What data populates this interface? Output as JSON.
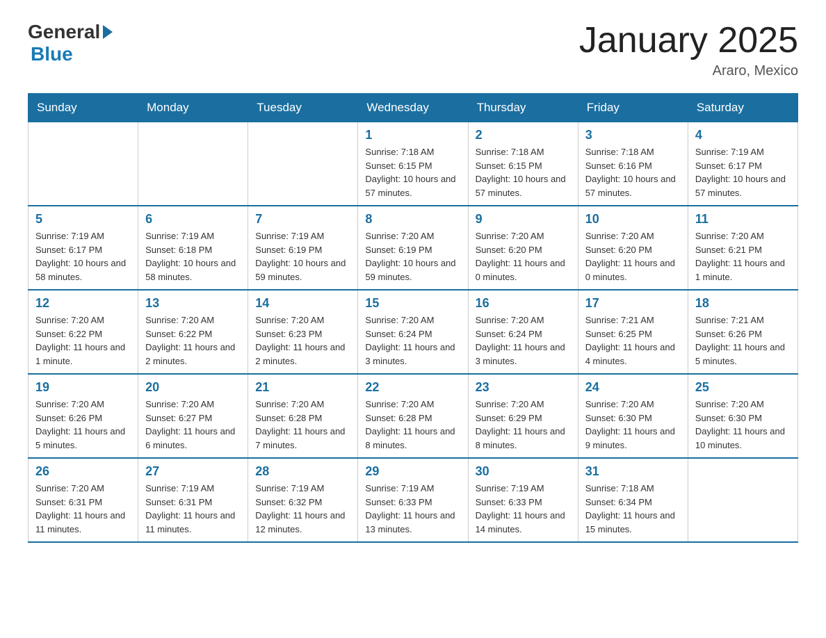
{
  "logo": {
    "general": "General",
    "blue": "Blue"
  },
  "header": {
    "title": "January 2025",
    "subtitle": "Araro, Mexico"
  },
  "days_of_week": [
    "Sunday",
    "Monday",
    "Tuesday",
    "Wednesday",
    "Thursday",
    "Friday",
    "Saturday"
  ],
  "weeks": [
    [
      {
        "day": "",
        "info": ""
      },
      {
        "day": "",
        "info": ""
      },
      {
        "day": "",
        "info": ""
      },
      {
        "day": "1",
        "info": "Sunrise: 7:18 AM\nSunset: 6:15 PM\nDaylight: 10 hours and 57 minutes."
      },
      {
        "day": "2",
        "info": "Sunrise: 7:18 AM\nSunset: 6:15 PM\nDaylight: 10 hours and 57 minutes."
      },
      {
        "day": "3",
        "info": "Sunrise: 7:18 AM\nSunset: 6:16 PM\nDaylight: 10 hours and 57 minutes."
      },
      {
        "day": "4",
        "info": "Sunrise: 7:19 AM\nSunset: 6:17 PM\nDaylight: 10 hours and 57 minutes."
      }
    ],
    [
      {
        "day": "5",
        "info": "Sunrise: 7:19 AM\nSunset: 6:17 PM\nDaylight: 10 hours and 58 minutes."
      },
      {
        "day": "6",
        "info": "Sunrise: 7:19 AM\nSunset: 6:18 PM\nDaylight: 10 hours and 58 minutes."
      },
      {
        "day": "7",
        "info": "Sunrise: 7:19 AM\nSunset: 6:19 PM\nDaylight: 10 hours and 59 minutes."
      },
      {
        "day": "8",
        "info": "Sunrise: 7:20 AM\nSunset: 6:19 PM\nDaylight: 10 hours and 59 minutes."
      },
      {
        "day": "9",
        "info": "Sunrise: 7:20 AM\nSunset: 6:20 PM\nDaylight: 11 hours and 0 minutes."
      },
      {
        "day": "10",
        "info": "Sunrise: 7:20 AM\nSunset: 6:20 PM\nDaylight: 11 hours and 0 minutes."
      },
      {
        "day": "11",
        "info": "Sunrise: 7:20 AM\nSunset: 6:21 PM\nDaylight: 11 hours and 1 minute."
      }
    ],
    [
      {
        "day": "12",
        "info": "Sunrise: 7:20 AM\nSunset: 6:22 PM\nDaylight: 11 hours and 1 minute."
      },
      {
        "day": "13",
        "info": "Sunrise: 7:20 AM\nSunset: 6:22 PM\nDaylight: 11 hours and 2 minutes."
      },
      {
        "day": "14",
        "info": "Sunrise: 7:20 AM\nSunset: 6:23 PM\nDaylight: 11 hours and 2 minutes."
      },
      {
        "day": "15",
        "info": "Sunrise: 7:20 AM\nSunset: 6:24 PM\nDaylight: 11 hours and 3 minutes."
      },
      {
        "day": "16",
        "info": "Sunrise: 7:20 AM\nSunset: 6:24 PM\nDaylight: 11 hours and 3 minutes."
      },
      {
        "day": "17",
        "info": "Sunrise: 7:21 AM\nSunset: 6:25 PM\nDaylight: 11 hours and 4 minutes."
      },
      {
        "day": "18",
        "info": "Sunrise: 7:21 AM\nSunset: 6:26 PM\nDaylight: 11 hours and 5 minutes."
      }
    ],
    [
      {
        "day": "19",
        "info": "Sunrise: 7:20 AM\nSunset: 6:26 PM\nDaylight: 11 hours and 5 minutes."
      },
      {
        "day": "20",
        "info": "Sunrise: 7:20 AM\nSunset: 6:27 PM\nDaylight: 11 hours and 6 minutes."
      },
      {
        "day": "21",
        "info": "Sunrise: 7:20 AM\nSunset: 6:28 PM\nDaylight: 11 hours and 7 minutes."
      },
      {
        "day": "22",
        "info": "Sunrise: 7:20 AM\nSunset: 6:28 PM\nDaylight: 11 hours and 8 minutes."
      },
      {
        "day": "23",
        "info": "Sunrise: 7:20 AM\nSunset: 6:29 PM\nDaylight: 11 hours and 8 minutes."
      },
      {
        "day": "24",
        "info": "Sunrise: 7:20 AM\nSunset: 6:30 PM\nDaylight: 11 hours and 9 minutes."
      },
      {
        "day": "25",
        "info": "Sunrise: 7:20 AM\nSunset: 6:30 PM\nDaylight: 11 hours and 10 minutes."
      }
    ],
    [
      {
        "day": "26",
        "info": "Sunrise: 7:20 AM\nSunset: 6:31 PM\nDaylight: 11 hours and 11 minutes."
      },
      {
        "day": "27",
        "info": "Sunrise: 7:19 AM\nSunset: 6:31 PM\nDaylight: 11 hours and 11 minutes."
      },
      {
        "day": "28",
        "info": "Sunrise: 7:19 AM\nSunset: 6:32 PM\nDaylight: 11 hours and 12 minutes."
      },
      {
        "day": "29",
        "info": "Sunrise: 7:19 AM\nSunset: 6:33 PM\nDaylight: 11 hours and 13 minutes."
      },
      {
        "day": "30",
        "info": "Sunrise: 7:19 AM\nSunset: 6:33 PM\nDaylight: 11 hours and 14 minutes."
      },
      {
        "day": "31",
        "info": "Sunrise: 7:18 AM\nSunset: 6:34 PM\nDaylight: 11 hours and 15 minutes."
      },
      {
        "day": "",
        "info": ""
      }
    ]
  ]
}
